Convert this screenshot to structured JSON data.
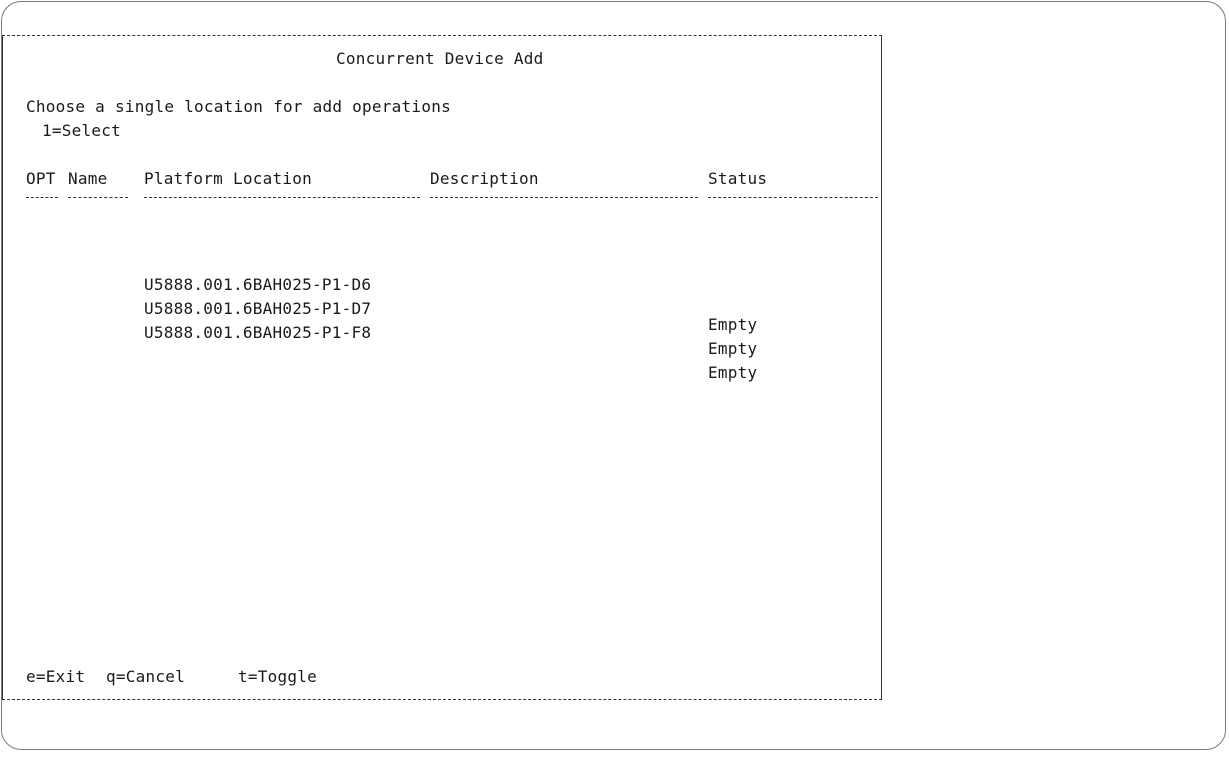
{
  "screen": {
    "title": "Concurrent Device Add",
    "instruction": "Choose a single location for add operations",
    "select_hint": "1=Select"
  },
  "table": {
    "headers": {
      "opt": "OPT",
      "name": "Name",
      "location": "Platform Location",
      "description": "Description",
      "status": "Status"
    },
    "rows": [
      {
        "opt": "",
        "name": "",
        "location": "U5888.001.6BAH025-P1-D6",
        "description": "",
        "status": "Empty"
      },
      {
        "opt": "",
        "name": "",
        "location": "U5888.001.6BAH025-P1-D7",
        "description": "",
        "status": "Empty"
      },
      {
        "opt": "",
        "name": "",
        "location": "U5888.001.6BAH025-P1-F8",
        "description": "",
        "status": "Empty"
      }
    ]
  },
  "footer": {
    "exit": "e=Exit",
    "cancel": "q=Cancel",
    "toggle": "t=Toggle"
  }
}
